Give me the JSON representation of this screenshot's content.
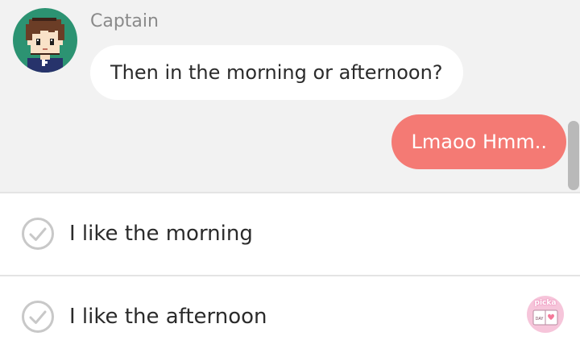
{
  "chat": {
    "sender_name": "Captain",
    "incoming_message": "Then in the morning or afternoon?",
    "outgoing_message": "Lmaoo Hmm.."
  },
  "choices": [
    {
      "label": "I like the morning"
    },
    {
      "label": "I like the afternoon"
    }
  ],
  "badge": {
    "word": "picka",
    "small_text": "DAY"
  },
  "colors": {
    "chat_background": "#f2f2f2",
    "avatar_background": "#2c9372",
    "outgoing_bubble": "#f47a74",
    "incoming_bubble": "#ffffff",
    "check_icon": "#c8c8c8"
  },
  "icons": {
    "avatar": "pixel-boy-avatar",
    "choice_check": "check-circle-icon",
    "badge": "pickaday-logo"
  }
}
